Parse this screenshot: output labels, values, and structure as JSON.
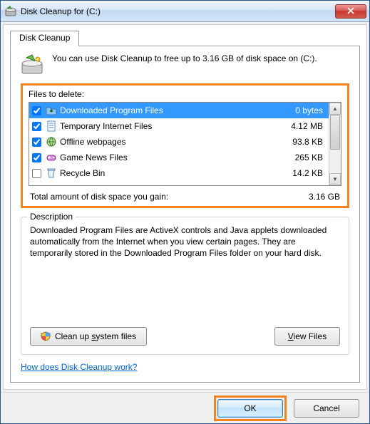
{
  "title": "Disk Cleanup for  (C:)",
  "tab": {
    "label": "Disk Cleanup"
  },
  "intro": "You can use Disk Cleanup to free up to 3.16 GB of disk space on (C:).",
  "files_label": "Files to delete:",
  "files": [
    {
      "name": "Downloaded Program Files",
      "size": "0 bytes",
      "checked": true,
      "selected": true,
      "icon": "folder-dl"
    },
    {
      "name": "Temporary Internet Files",
      "size": "4.12 MB",
      "checked": true,
      "selected": false,
      "icon": "page"
    },
    {
      "name": "Offline webpages",
      "size": "93.8 KB",
      "checked": true,
      "selected": false,
      "icon": "web"
    },
    {
      "name": "Game News Files",
      "size": "265 KB",
      "checked": true,
      "selected": false,
      "icon": "game"
    },
    {
      "name": "Recycle Bin",
      "size": "14.2 KB",
      "checked": false,
      "selected": false,
      "icon": "bin"
    }
  ],
  "total_label": "Total amount of disk space you gain:",
  "total_value": "3.16 GB",
  "description": {
    "legend": "Description",
    "text": "Downloaded Program Files are ActiveX controls and Java applets downloaded automatically from the Internet when you view certain pages. They are temporarily stored in the Downloaded Program Files folder on your hard disk."
  },
  "buttons": {
    "cleanup_system": "Clean up system files",
    "view_files": "View Files",
    "ok": "OK",
    "cancel": "Cancel"
  },
  "help_link": "How does Disk Cleanup work?"
}
